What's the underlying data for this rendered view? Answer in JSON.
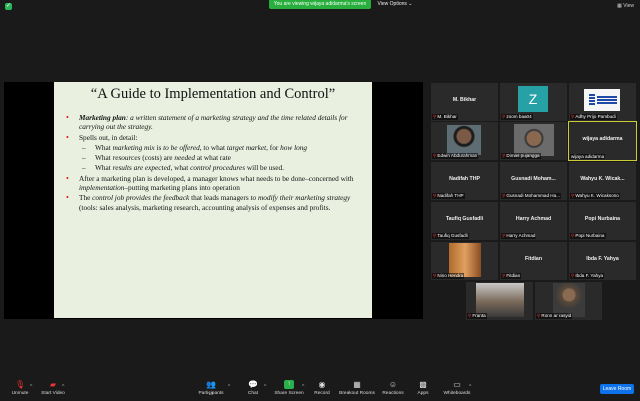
{
  "top": {
    "share_banner": "You are viewing wijaya adidarma's screen",
    "view_options": "View Options",
    "view": "View"
  },
  "slide": {
    "title": "“A Guide to Implementation and Control”",
    "b1_bold": "Marketing plan",
    "b1_rest": ": a written statement of a marketing strategy and the time related details for carrying out the strategy.",
    "b2": "Spells out, in detail:",
    "s1_a": "What ",
    "s1_b": "marketing mix",
    "s1_c": " is ",
    "s1_d": "to be offered",
    "s1_e": ", to what ",
    "s1_f": "target market",
    "s1_g": ", for ",
    "s1_h": "how long",
    "s2_a": "What ",
    "s2_b": "resources",
    "s2_c": " (costs) are ",
    "s2_d": "needed",
    "s2_e": " at what rate",
    "s3_a": "What ",
    "s3_b": "results are expected",
    "s3_c": ", what ",
    "s3_d": "control procedures",
    "s3_e": " will be used.",
    "b3_a": "After a marketing plan is developed, a manager knows what needs to be done–concerned with ",
    "b3_b": "implementation",
    "b3_c": "–putting marketing plans into operation",
    "b4_a": "The ",
    "b4_b": "control job provides the feedback",
    "b4_c": " that leads managers ",
    "b4_d": "to modify their marketing strategy",
    "b4_e": " (tools: sales analysis, marketing research, accounting analysis of expenses and profits."
  },
  "participants": [
    {
      "name": "M. Bikhar",
      "label": "M. Bikhar"
    },
    {
      "name": "",
      "label": "zoom baa04",
      "avatar": "Z"
    },
    {
      "name": "",
      "label": "Adhy Prijo Pambudi"
    },
    {
      "name": "",
      "label": "Edwin Abdurahman"
    },
    {
      "name": "",
      "label": "Dimas pujangga"
    },
    {
      "name": "wijaya adidarma",
      "label": "wijaya adidarma"
    },
    {
      "name": "Nadifah THP",
      "label": "Nadifah THP"
    },
    {
      "name": "Gusnadi Moham...",
      "label": "Gusnadi Mohammad Ha..."
    },
    {
      "name": "Wahyu K. Wicak...",
      "label": "Wahyu K. Wicaksono"
    },
    {
      "name": "Taufiq Gusfadli",
      "label": "Taufiq Gusfadli"
    },
    {
      "name": "Harry Achmad",
      "label": "Harry Achmad"
    },
    {
      "name": "Popi Nurbaina",
      "label": "Popi Nurbaina"
    },
    {
      "name": "",
      "label": "Nino Hendra"
    },
    {
      "name": "Fitdian",
      "label": "Fitdian"
    },
    {
      "name": "Ibda F. Yahya",
      "label": "Ibda F. Yahya"
    },
    {
      "name": "",
      "label": "Franta"
    },
    {
      "name": "",
      "label": "Ronn ar rasyid"
    }
  ],
  "toolbar": {
    "unmute": "Unmute",
    "start_video": "Start Video",
    "participants": "Participants",
    "participants_count": "17",
    "chat": "Chat",
    "share_screen": "Share Screen",
    "record": "Record",
    "breakout": "Breakout Rooms",
    "reactions": "Reactions",
    "apps": "Apps",
    "whiteboards": "Whiteboards",
    "leave": "Leave Room"
  },
  "colors": {
    "accent_green": "#27ae3c",
    "leave_blue": "#0e72ed",
    "highlight": "#c9cc32",
    "bullet": "#d11111"
  }
}
